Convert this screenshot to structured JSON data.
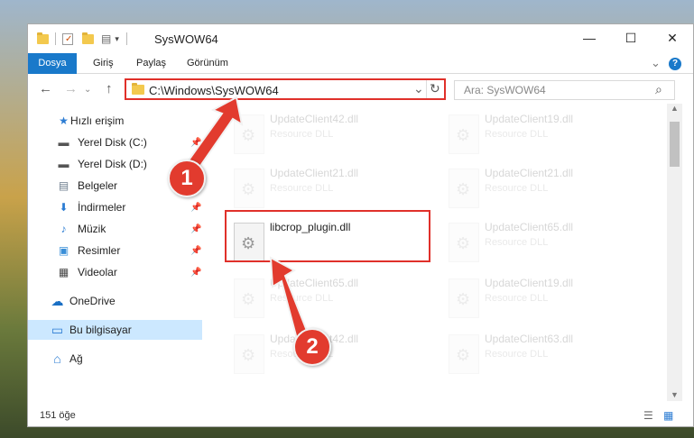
{
  "window": {
    "title": "SysWOW64",
    "controls": {
      "minimize": "—",
      "maximize": "☐",
      "close": "✕"
    }
  },
  "ribbon": {
    "tabs": [
      "Dosya",
      "Giriş",
      "Paylaş",
      "Görünüm"
    ],
    "accent_color": "#1979ca",
    "expand_glyph": "⌄",
    "help_glyph": "?"
  },
  "nav": {
    "back": "←",
    "forward": "→",
    "up": "↑",
    "address": "C:\\Windows\\SysWOW64",
    "refresh": "↻",
    "dropdown": "⌄",
    "search_placeholder": "Ara: SysWOW64",
    "search_glyph": "⌕"
  },
  "sidebar": {
    "items": [
      {
        "label": "Hızlı erişim",
        "icon": "star-icon",
        "glyph": "★",
        "pinned": false
      },
      {
        "label": "Yerel Disk (C:)",
        "icon": "drive-icon",
        "glyph": "▬",
        "pinned": true
      },
      {
        "label": "Yerel Disk (D:)",
        "icon": "drive-icon",
        "glyph": "▬",
        "pinned": true
      },
      {
        "label": "Belgeler",
        "icon": "documents-icon",
        "glyph": "▤",
        "pinned": true
      },
      {
        "label": "İndirmeler",
        "icon": "download-icon",
        "glyph": "⬇",
        "pinned": true
      },
      {
        "label": "Müzik",
        "icon": "music-icon",
        "glyph": "♪",
        "pinned": true
      },
      {
        "label": "Resimler",
        "icon": "pictures-icon",
        "glyph": "▣",
        "pinned": true
      },
      {
        "label": "Videolar",
        "icon": "videos-icon",
        "glyph": "▦",
        "pinned": true
      },
      {
        "label": "OneDrive",
        "icon": "cloud-icon",
        "glyph": "☁",
        "pinned": false
      },
      {
        "label": "Bu bilgisayar",
        "icon": "computer-icon",
        "glyph": "▭",
        "pinned": false,
        "selected": true
      },
      {
        "label": "Ağ",
        "icon": "network-icon",
        "glyph": "⌂",
        "pinned": false
      }
    ],
    "pin_glyph": "📌"
  },
  "files": [
    {
      "name": "UpdateClient42.dll",
      "type": "Resource DLL",
      "faded": true
    },
    {
      "name": "UpdateClient19.dll",
      "type": "Resource DLL",
      "faded": true
    },
    {
      "name": "UpdateClient21.dll",
      "type": "Resource DLL",
      "faded": true
    },
    {
      "name": "UpdateClient21.dll",
      "type": "Resource DLL",
      "faded": true
    },
    {
      "name": "libcrop_plugin.dll",
      "type": "",
      "faded": false
    },
    {
      "name": "UpdateClient65.dll",
      "type": "Resource DLL",
      "faded": true
    },
    {
      "name": "UpdateClient65.dll",
      "type": "Resource DLL",
      "faded": true
    },
    {
      "name": "UpdateClient19.dll",
      "type": "Resource DLL",
      "faded": true
    },
    {
      "name": "UpdateClient42.dll",
      "type": "Resource DLL",
      "faded": true
    },
    {
      "name": "UpdateClient63.dll",
      "type": "Resource DLL",
      "faded": true
    }
  ],
  "status": {
    "item_count": "151 öğe",
    "view_details_glyph": "☰",
    "view_tiles_glyph": "▦"
  },
  "annotations": {
    "step1": "1",
    "step2": "2",
    "highlight_color": "#e0302a"
  }
}
